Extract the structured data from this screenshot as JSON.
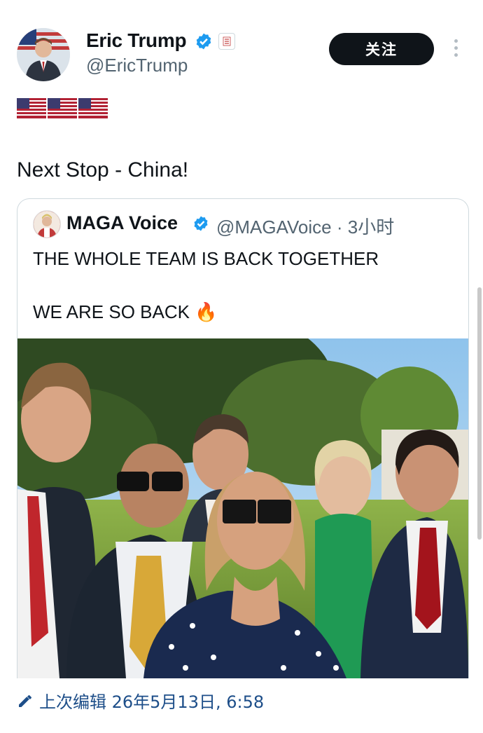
{
  "author": {
    "display_name": "Eric Trump",
    "handle": "@EricTrump"
  },
  "follow_button": "关注",
  "tweet": {
    "flags": "🇺🇸🇺🇸🇺🇸",
    "text": "Next Stop - China!"
  },
  "quoted": {
    "display_name": "MAGA Voice",
    "handle_time": "@MAGAVoice · 3小时",
    "line1": "THE WHOLE TEAM IS BACK TOGETHER",
    "line2": "WE ARE SO BACK 🔥"
  },
  "footer": {
    "edited": "上次编辑 26年5月13日, 6:58"
  },
  "colors": {
    "verified_blue": "#1d9bf0",
    "follow_bg": "#0f1419",
    "link_blue": "#1d4e89"
  },
  "icons": [
    "verified-icon",
    "affiliation-icon",
    "more-icon",
    "edit-icon"
  ]
}
